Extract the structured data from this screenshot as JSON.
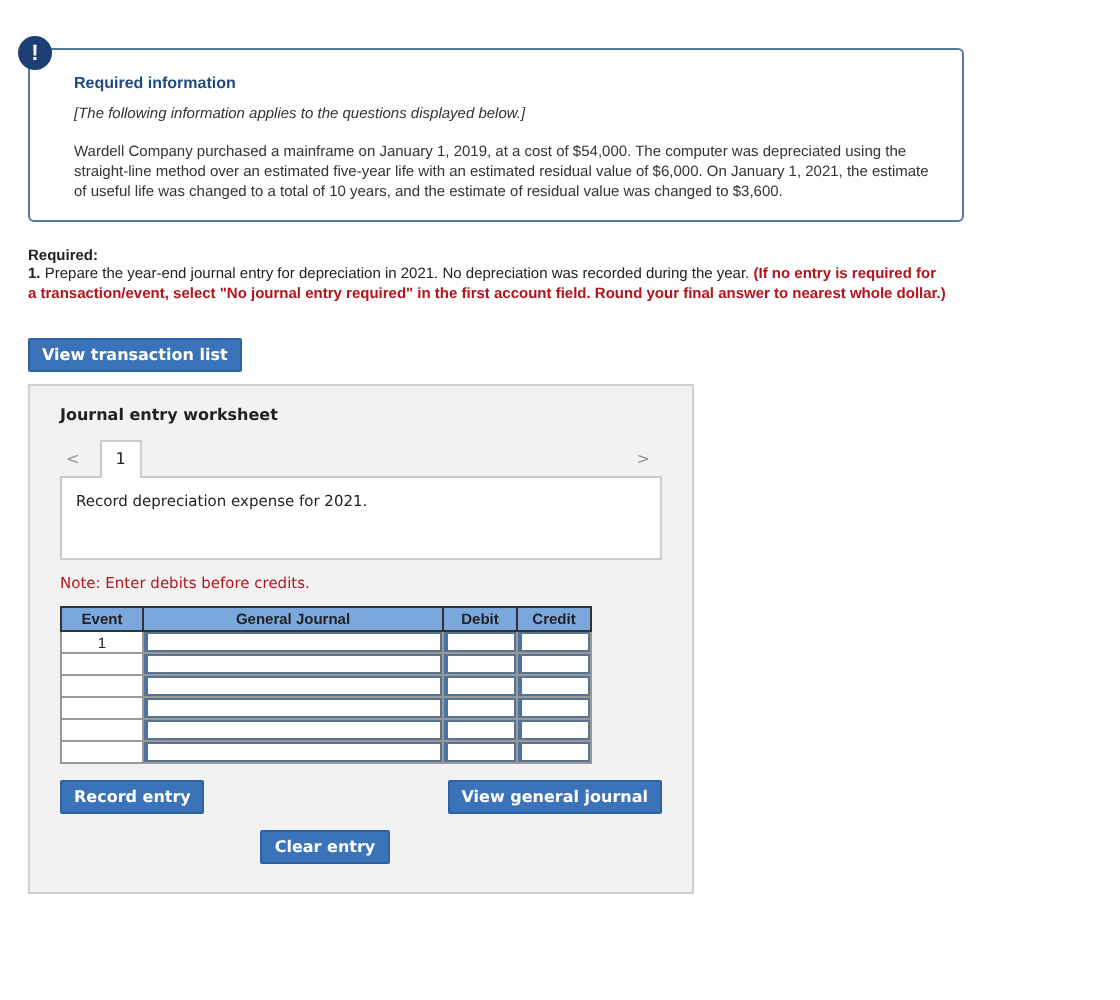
{
  "info": {
    "alert": "!",
    "title": "Required information",
    "subtitle": "[The following information applies to the questions displayed below.]",
    "body": "Wardell Company purchased a mainframe on January 1, 2019, at a cost of $54,000. The computer was depreciated using the straight-line method over an estimated five-year life with an estimated residual value of $6,000. On January 1, 2021, the estimate of useful life was changed to a total of 10 years, and the estimate of residual value was changed to $3,600."
  },
  "required": {
    "label": "Required:",
    "text": "**1.** Prepare the year-end journal entry for depreciation in 2021. No depreciation was recorded during the year.",
    "instruction": "(If no entry is required for a transaction/event, select \"No journal entry required\" in the first account field. Round your final answer to nearest whole dollar.)"
  },
  "view_transaction_button": "View transaction list",
  "worksheet": {
    "title": "Journal entry worksheet",
    "prev": "<",
    "next": ">",
    "tabs": [
      {
        "label": "1",
        "selected": true
      }
    ],
    "description": "Record depreciation expense for 2021.",
    "note": "Note: Enter debits before credits.",
    "columns": [
      "Event",
      "General Journal",
      "Debit",
      "Credit"
    ],
    "rows": [
      {
        "event": "1"
      },
      {},
      {},
      {},
      {},
      {}
    ],
    "buttons": {
      "record": "Record entry",
      "view_journal": "View general journal",
      "clear": "Clear entry"
    }
  }
}
